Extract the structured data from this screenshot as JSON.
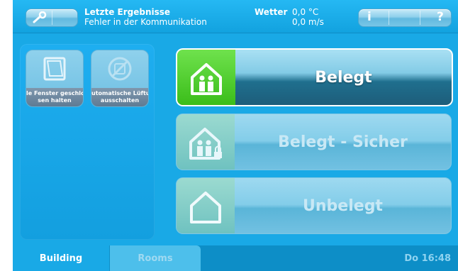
{
  "header": {
    "status_line1": "Letzte Ergebnisse",
    "status_line2": "Fehler in der Kommunikation",
    "weather_label": "Wetter",
    "weather_temp": "0,0 °C",
    "weather_wind": "0,0 m/s",
    "tool_icon": "wrench-icon",
    "info_label": "i",
    "help_label": "?"
  },
  "actions": [
    {
      "label": "le Fenster geschlo",
      "label2": "sen halten",
      "icon": "window-icon"
    },
    {
      "label": "utomatische Lüftun",
      "label2": "ausschalten",
      "icon": "no-ventilation-icon"
    }
  ],
  "modes": [
    {
      "label": "Belegt",
      "icon": "occupied-house-icon",
      "active": true
    },
    {
      "label": "Belegt - Sicher",
      "icon": "occupied-secure-house-icon",
      "active": false
    },
    {
      "label": "Unbelegt",
      "icon": "empty-house-icon",
      "active": false
    }
  ],
  "footer": {
    "tabs": [
      "Building",
      "Rooms"
    ],
    "active_tab": "Building",
    "time": "Do 16:48"
  },
  "colors": {
    "background": "#19a9e6",
    "active_green": "#4ccd2a"
  }
}
